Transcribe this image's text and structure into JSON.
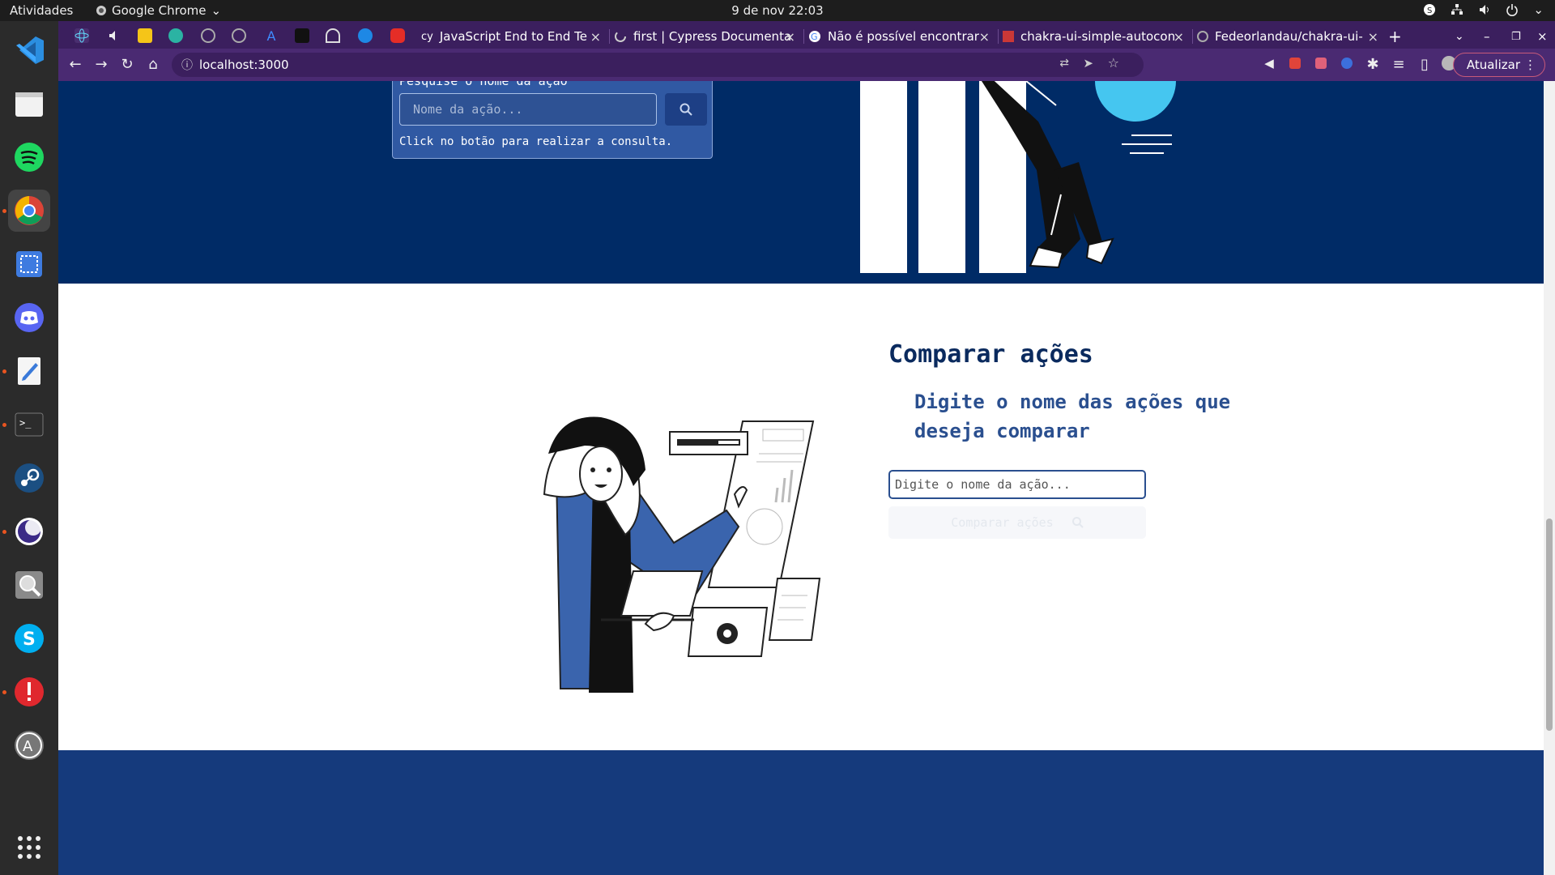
{
  "system": {
    "activities": "Atividades",
    "app_name": "Google Chrome",
    "clock": "9 de nov  22:03"
  },
  "browser": {
    "tabs": [
      {
        "label": "JavaScript End to End Te"
      },
      {
        "label": "first | Cypress Documenta"
      },
      {
        "label": "Não é possível encontrar"
      },
      {
        "label": "chakra-ui-simple-autocon"
      },
      {
        "label": "Fedeorlandau/chakra-ui-"
      }
    ],
    "url": "localhost:3000",
    "update_label": "Atualizar"
  },
  "page": {
    "search_card": {
      "title": "Pesquise o nome da ação",
      "input_placeholder": "Nome da ação...",
      "hint": "Click no botão para realizar a consulta."
    },
    "compare": {
      "title": "Comparar ações",
      "subtitle": "Digite o nome das ações que deseja comparar",
      "input_placeholder": "Digite o nome da ação...",
      "button_label": "Comparar ações"
    }
  },
  "colors": {
    "hero_bg": "#002b66",
    "footer_bg": "#153a7c",
    "accent_blue": "#3059a3",
    "illustration_blue": "#3a64ad",
    "tab_strip": "#3b1f5e"
  },
  "icons": {
    "dock": [
      "vscode-icon",
      "files-icon",
      "spotify-icon",
      "chrome-icon",
      "screenshot-icon",
      "discord-icon",
      "text-editor-icon",
      "terminal-icon",
      "steam-icon",
      "eclipse-icon",
      "magnifier-icon",
      "skype-icon",
      "alert-icon",
      "software-center-icon",
      "apps-grid-icon"
    ]
  }
}
